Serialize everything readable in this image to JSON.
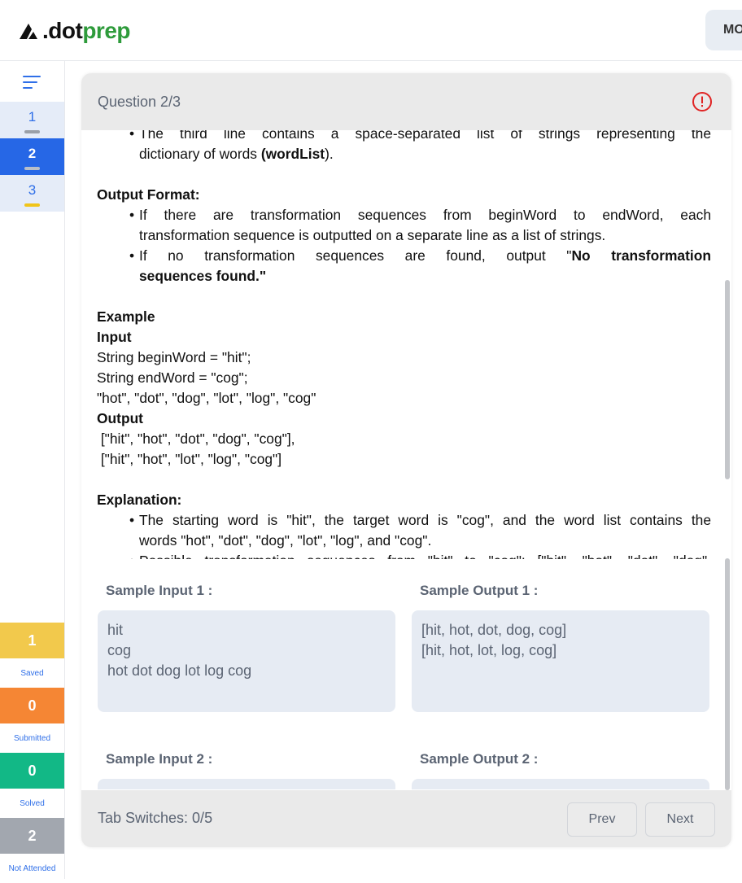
{
  "header": {
    "logo_dot": ".dot",
    "logo_prep": "prep",
    "mode_button": "MO"
  },
  "sidebar": {
    "questions": [
      {
        "label": "1",
        "state": "saved"
      },
      {
        "label": "2",
        "state": "current"
      },
      {
        "label": "3",
        "state": "saved"
      }
    ],
    "stats": {
      "saved": {
        "count": "1",
        "label": "Saved"
      },
      "submitted": {
        "count": "0",
        "label": "Submitted"
      },
      "solved": {
        "count": "0",
        "label": "Solved"
      },
      "not_attended": {
        "count": "2",
        "label": "Not Attended"
      }
    }
  },
  "question": {
    "title": "Question 2/3",
    "desc": {
      "b1_l1": "The third line contains a space-separated list of strings representing the",
      "b1_l2_a": "dictionary of words ",
      "b1_l2_b": "(wordList",
      "b1_l2_c": ").",
      "output_format": "Output Format:",
      "of_b1_l1": "If there are transformation sequences from beginWord to endWord, each",
      "of_b1_l2": "transformation sequence is outputted on a separate line as a list of strings.",
      "of_b2_l1_a": "If no transformation sequences are found, output \"",
      "of_b2_l1_b": "No transformation",
      "of_b2_l2": "sequences found.\"",
      "example": "Example",
      "input": "Input",
      "in_l1": "String beginWord = \"hit\";",
      "in_l2": "String endWord = \"cog\";",
      "in_l3": "\"hot\", \"dot\", \"dog\", \"lot\", \"log\", \"cog\"",
      "output": "Output",
      "out_l1": " [\"hit\", \"hot\", \"dot\", \"dog\", \"cog\"],",
      "out_l2": " [\"hit\", \"hot\", \"lot\", \"log\", \"cog\"]",
      "explanation": "Explanation:",
      "ex_b1_l1": "The starting word is \"hit\", the target word is \"cog\", and the word list contains the",
      "ex_b1_l2": "words \"hot\", \"dot\", \"dog\", \"lot\", \"log\", and \"cog\".",
      "ex_b2_l1": "Possible transformation sequences from \"hit\" to \"cog\": [\"hit\", \"hot\", \"dot\", \"dog\","
    },
    "samples": {
      "in1_title": "Sample Input 1 :",
      "in1_value": "hit\ncog\nhot dot dog lot log cog",
      "out1_title": "Sample Output 1 :",
      "out1_value": "[hit, hot, dot, dog, cog]\n[hit, hot, lot, log, cog]",
      "in2_title": "Sample Input 2 :",
      "in2_value": "",
      "out2_title": "Sample Output 2 :",
      "out2_value": ""
    },
    "footer": {
      "tab_switches": "Tab Switches:  0/5",
      "prev": "Prev",
      "next": "Next"
    }
  },
  "colors": {
    "accent": "#2667e6",
    "brand_green": "#2e9b3b",
    "saved": "#f2c94c",
    "submitted": "#f58634",
    "solved": "#12b886",
    "not_attended": "#a2a7af",
    "alert": "#e02424"
  }
}
